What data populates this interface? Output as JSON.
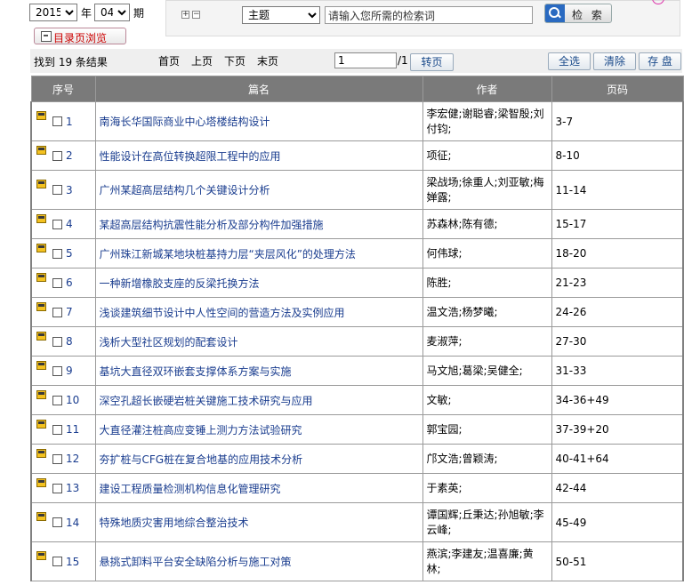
{
  "filters": {
    "year": "2015",
    "year_unit": "年",
    "issue": "04",
    "issue_unit": "期",
    "dir_button": "目录页浏览"
  },
  "search": {
    "field": "主题",
    "keyword_placeholder": "请输入您所需的检索词",
    "button": "检 索"
  },
  "toolbar": {
    "result_text": "找到 19 条结果",
    "first_page": "首页",
    "prev_page": "上页",
    "next_page": "下页",
    "last_page": "末页",
    "page_value": "1",
    "page_total": "/1",
    "goto": "转页",
    "select_all": "全选",
    "clear": "清除",
    "save": "存 盘"
  },
  "table": {
    "headers": [
      "序号",
      "篇名",
      "作者",
      "页码"
    ],
    "rows": [
      {
        "no": "1",
        "title": "南海长华国际商业中心塔楼结构设计",
        "authors": "李宏健;谢聪睿;梁智殷;刘付钧;",
        "pages": "3-7"
      },
      {
        "no": "2",
        "title": "性能设计在高位转换超限工程中的应用",
        "authors": "项征;",
        "pages": "8-10"
      },
      {
        "no": "3",
        "title": "广州某超高层结构几个关键设计分析",
        "authors": "梁战场;徐重人;刘亚敏;梅婵露;",
        "pages": "11-14"
      },
      {
        "no": "4",
        "title": "某超高层结构抗震性能分析及部分构件加强措施",
        "authors": "苏森林;陈有德;",
        "pages": "15-17"
      },
      {
        "no": "5",
        "title": "广州珠江新城某地块桩基持力层“夹层风化”的处理方法",
        "authors": "何伟球;",
        "pages": "18-20"
      },
      {
        "no": "6",
        "title": "一种新增橡胶支座的反梁托换方法",
        "authors": "陈胜;",
        "pages": "21-23"
      },
      {
        "no": "7",
        "title": "浅谈建筑细节设计中人性空间的营造方法及实例应用",
        "authors": "温文浩;杨梦曦;",
        "pages": "24-26"
      },
      {
        "no": "8",
        "title": "浅析大型社区规划的配套设计",
        "authors": "麦淑萍;",
        "pages": "27-30"
      },
      {
        "no": "9",
        "title": "基坑大直径双环嵌套支撑体系方案与实施",
        "authors": "马文旭;葛梁;吴健全;",
        "pages": "31-33"
      },
      {
        "no": "10",
        "title": "深空孔超长嵌硬岩桩关键施工技术研究与应用",
        "authors": "文敏;",
        "pages": "34-36+49"
      },
      {
        "no": "11",
        "title": "大直径灌注桩高应变锤上测力方法试验研究",
        "authors": "郭宝园;",
        "pages": "37-39+20"
      },
      {
        "no": "12",
        "title": "夯扩桩与CFG桩在复合地基的应用技术分析",
        "authors": "邝文浩;曾颖涛;",
        "pages": "40-41+64"
      },
      {
        "no": "13",
        "title": "建设工程质量检测机构信息化管理研究",
        "authors": "于素英;",
        "pages": "42-44"
      },
      {
        "no": "14",
        "title": "特殊地质灾害用地综合整治技术",
        "authors": "谭国辉;丘秉达;孙旭敏;李云峰;",
        "pages": "45-49"
      },
      {
        "no": "15",
        "title": "悬挑式卸料平台安全缺陷分析与施工对策",
        "authors": "燕滨;李建友;温喜廉;黄林;",
        "pages": "50-51"
      }
    ]
  }
}
